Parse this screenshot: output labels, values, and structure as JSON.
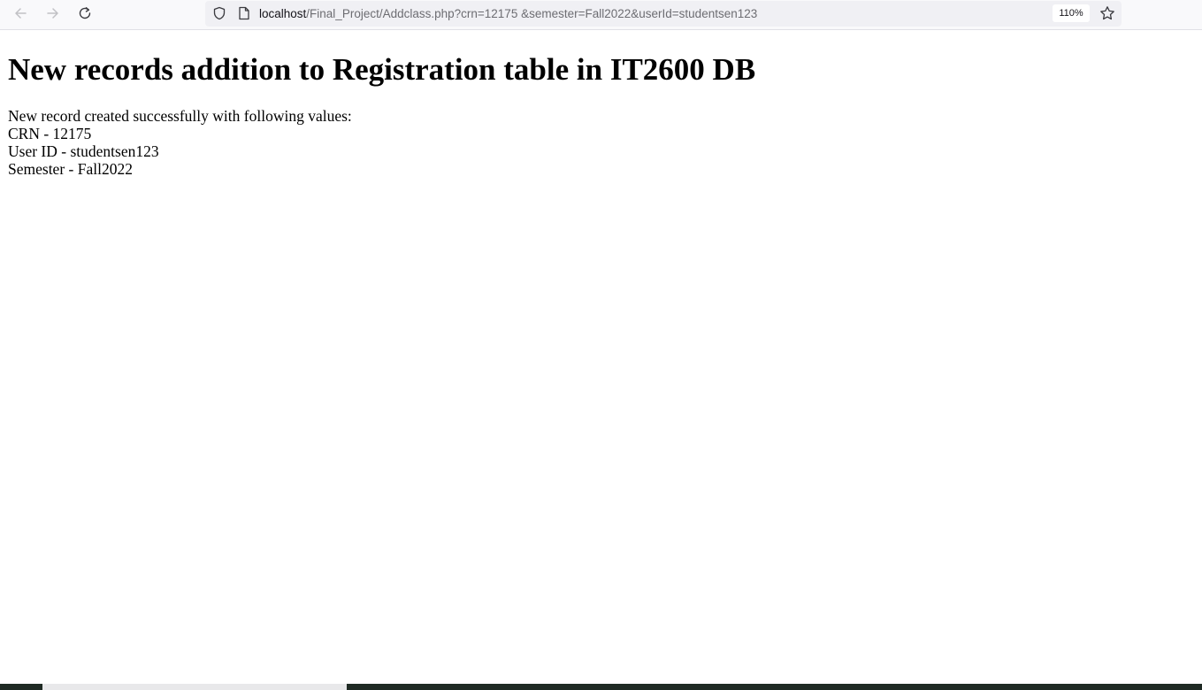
{
  "browser": {
    "url_host": "localhost",
    "url_path": "/Final_Project/Addclass.php?crn=12175 &semester=Fall2022&userId=studentsen123",
    "zoom": "110%"
  },
  "page": {
    "heading": "New records addition to Registration table in IT2600 DB",
    "lines": [
      "New record created successfully with following values:",
      "CRN - 12175",
      "User ID - studentsen123",
      "Semester - Fall2022"
    ]
  },
  "icons": {
    "back": "arrow-left-icon",
    "forward": "arrow-right-icon",
    "reload": "reload-icon",
    "tracking": "shield-icon",
    "page": "page-icon",
    "bookmark": "star-icon"
  }
}
